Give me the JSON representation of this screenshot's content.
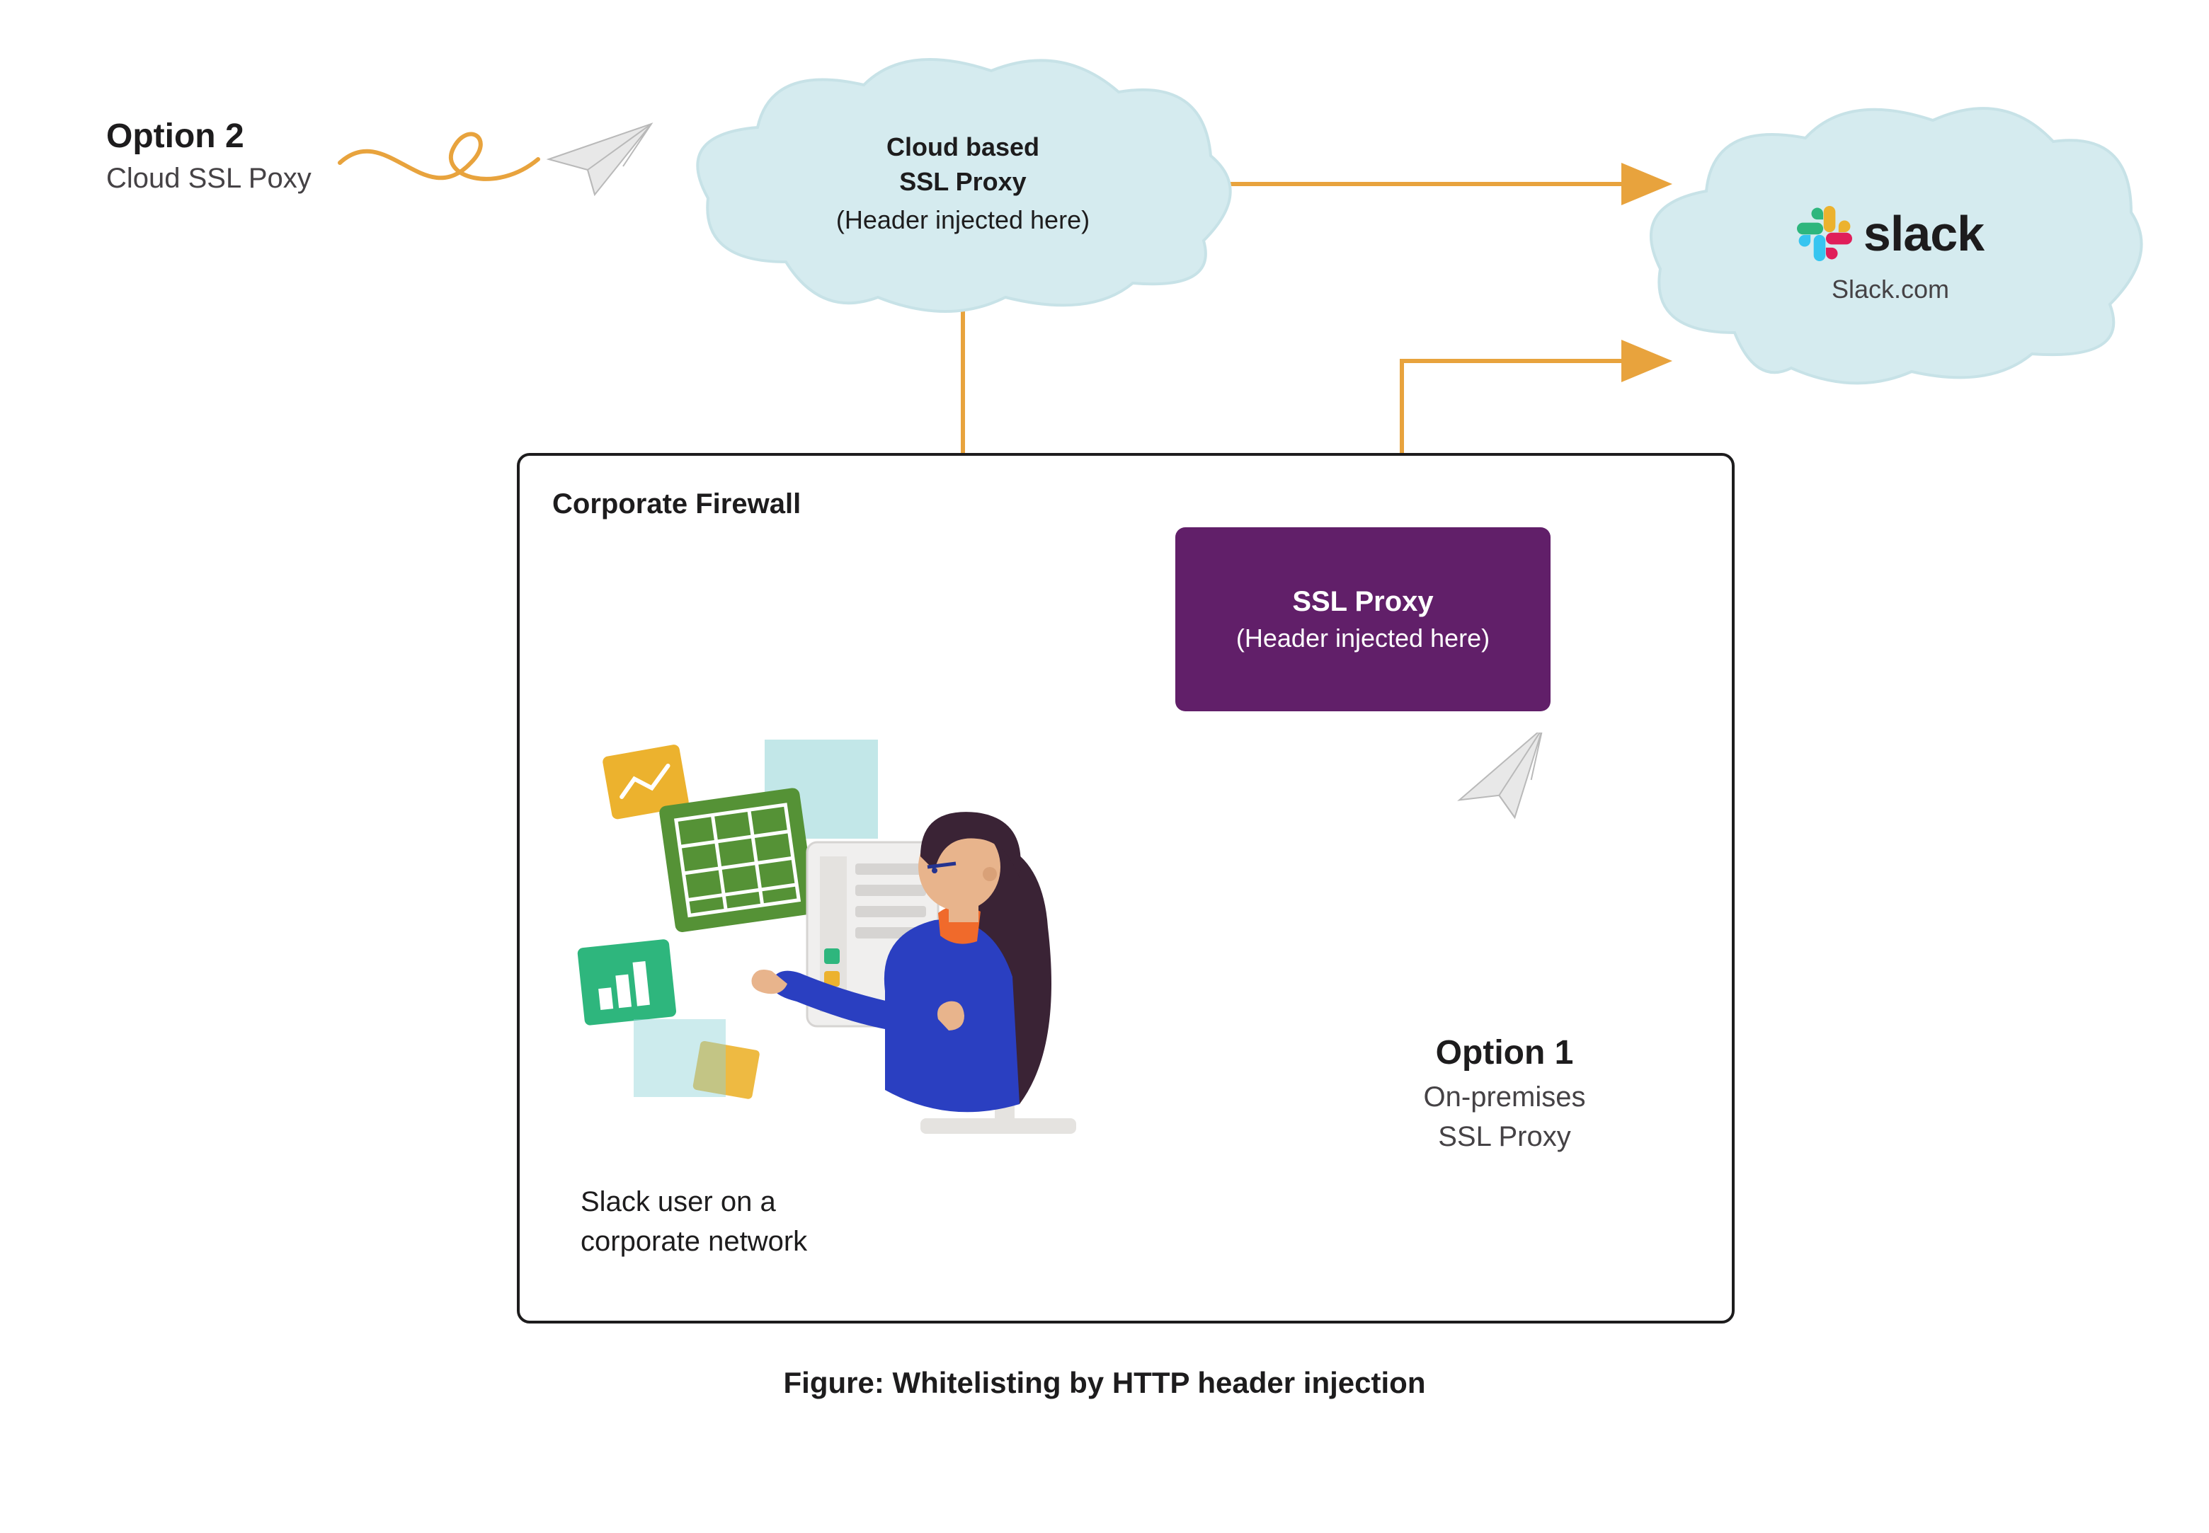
{
  "option2": {
    "title": "Option 2",
    "subtitle": "Cloud SSL Poxy"
  },
  "cloud_proxy": {
    "line1": "Cloud based",
    "line2": "SSL Proxy",
    "line3": "(Header injected here)"
  },
  "slack": {
    "word": "slack",
    "sub": "Slack.com"
  },
  "firewall_label": "Corporate Firewall",
  "ssl_box": {
    "line1": "SSL Proxy",
    "line2": "(Header injected here)"
  },
  "option1": {
    "title": "Option 1",
    "sub1": "On-premises",
    "sub2": "SSL Proxy"
  },
  "user_caption_line1": "Slack user on a",
  "user_caption_line2": "corporate network",
  "figure_title": "Figure: Whitelisting by HTTP header injection",
  "colors": {
    "amber": "#e8a33d",
    "cloud_fill": "#d5ebef",
    "cloud_stroke": "#c7e2e7",
    "purple": "#611f69",
    "teal": "#2eb67d",
    "green": "#559236",
    "yellow": "#ecb22e",
    "blue": "#2a3fc1",
    "red": "#e01e5a"
  }
}
